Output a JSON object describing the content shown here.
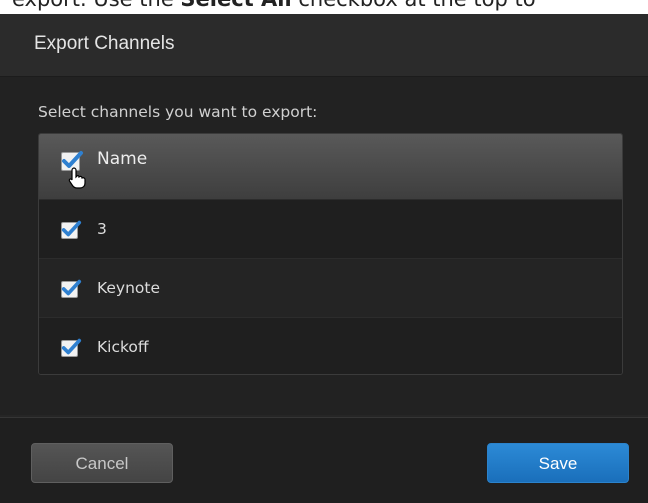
{
  "top_caption": {
    "prefix": "export. Use the ",
    "bold": "Select All",
    "suffix": " checkbox at the top to"
  },
  "dialog": {
    "title": "Export Channels",
    "instructions": "Select channels you want to export:",
    "select_all": {
      "label": "Name",
      "checked": true
    },
    "channels": [
      {
        "label": "3",
        "checked": true
      },
      {
        "label": "Keynote",
        "checked": true
      },
      {
        "label": "Kickoff",
        "checked": true
      }
    ],
    "buttons": {
      "cancel": "Cancel",
      "save": "Save"
    }
  },
  "colors": {
    "check_blue": "#2f80d0",
    "save_blue": "#1f78c6",
    "dialog_bg": "#262626"
  },
  "icons": {
    "checkmark": "checkmark-icon",
    "cursor": "hand-pointer-icon"
  }
}
